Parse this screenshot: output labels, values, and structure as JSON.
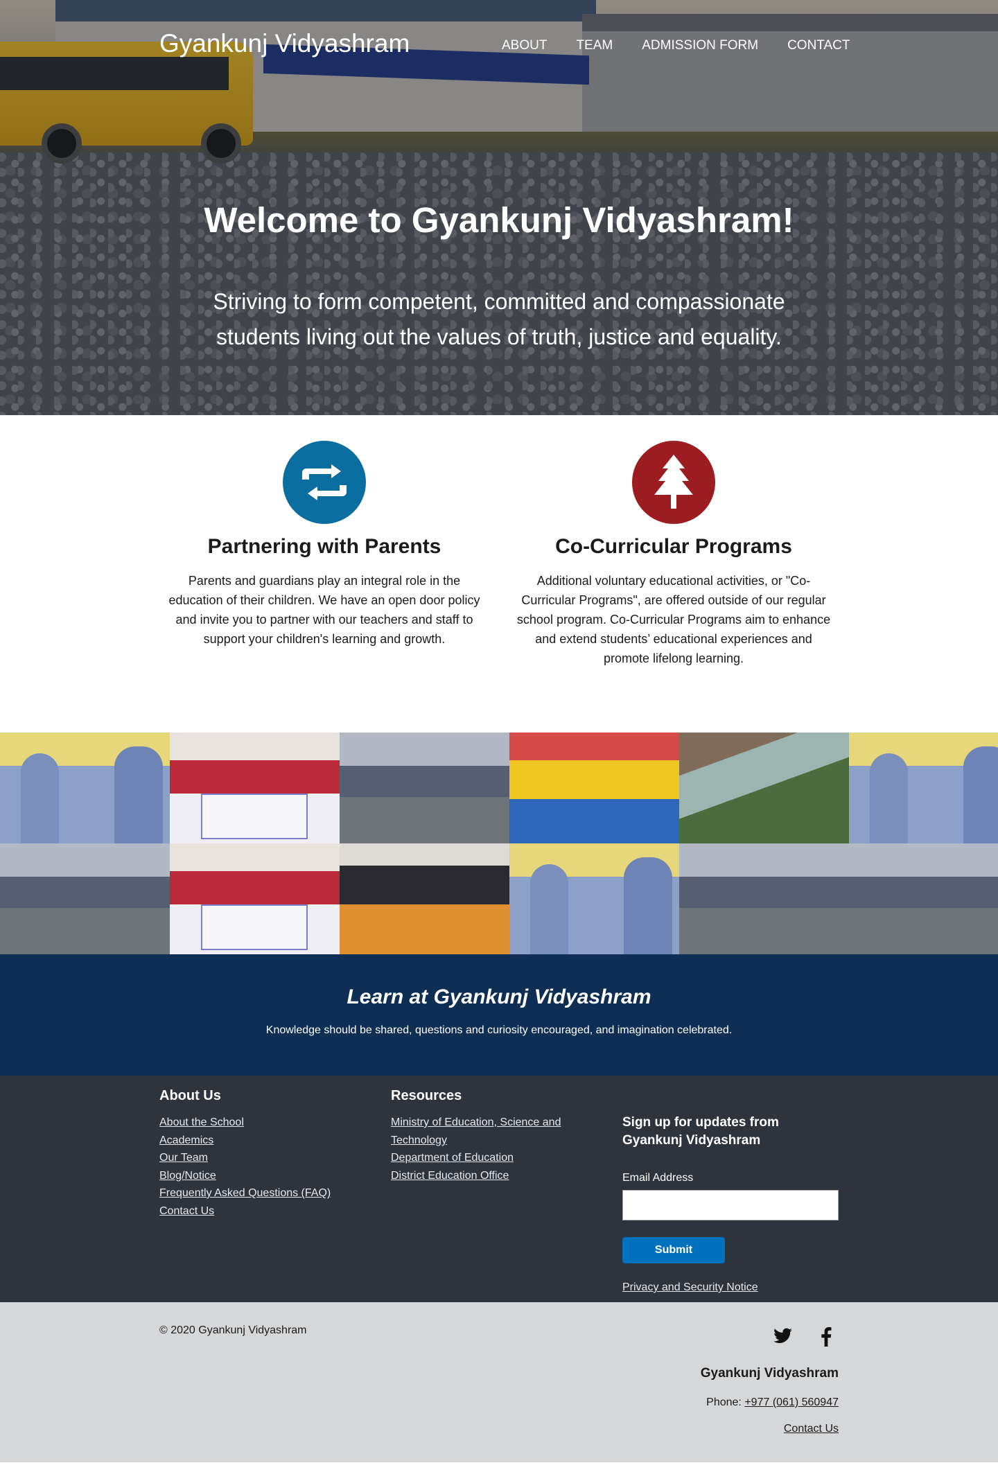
{
  "nav": {
    "brand": "Gyankunj Vidyashram",
    "links": [
      "ABOUT",
      "TEAM",
      "ADMISSION FORM",
      "CONTACT"
    ]
  },
  "hero": {
    "title": "Welcome to Gyankunj Vidyashram!",
    "subtitle": "Striving to form competent, committed and compassionate students living out the values of truth, justice and equality."
  },
  "features": [
    {
      "title": "Partnering with Parents",
      "text": "Parents and guardians play an integral role in the education of their children. We have an open door policy and invite you to partner with our teachers and staff to support your children's learning and growth.",
      "icon": "retweet-icon",
      "color": "#0b6ea0"
    },
    {
      "title": "Co-Curricular Programs",
      "text": "Additional voluntary educational activities, or \"Co-Curricular Programs\", are offered outside of our regular school program. Co-Curricular Programs aim to enhance and extend students’ educational experiences and promote lifelong learning.",
      "icon": "tree-icon",
      "color": "#9c1d21"
    }
  ],
  "learn": {
    "title": "Learn at Gyankunj Vidyashram",
    "text": "Knowledge should be shared, questions and curiosity encouraged, and imagination celebrated."
  },
  "footer": {
    "about_title": "About Us",
    "about_links": [
      "About the School",
      "Academics",
      "Our Team",
      "Blog/Notice",
      "Frequently Asked Questions (FAQ)",
      "Contact Us"
    ],
    "resources_title": "Resources",
    "resources_links": [
      "Ministry of Education, Science and Technology",
      "Department of Education",
      "District Education Office"
    ],
    "signup_title": "Sign up for updates from Gyankunj Vidyashram",
    "email_label": "Email Address",
    "submit_label": "Submit",
    "privacy_label": "Privacy and Security Notice"
  },
  "bottom": {
    "copyright": "© 2020 Gyankunj Vidyashram",
    "org_name": "Gyankunj Vidyashram",
    "phone_label": "Phone:",
    "phone": "+977 (061) 560947",
    "contact": "Contact Us",
    "twitter": "twitter-icon",
    "facebook": "facebook-icon"
  },
  "colors": {
    "learn_band": "#0e2e54",
    "footer": "#2e343d",
    "bottom": "#d6d7d9",
    "submit": "#0071bc"
  }
}
